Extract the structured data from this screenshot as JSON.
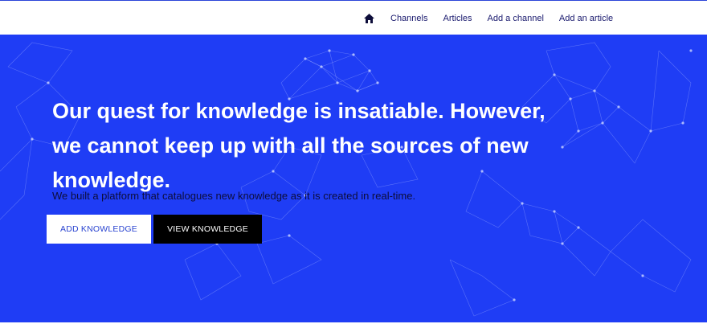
{
  "nav": {
    "home_icon": "home-icon",
    "links": [
      "Channels",
      "Articles",
      "Add a channel",
      "Add an article"
    ]
  },
  "hero": {
    "headline_lines": [
      "Our quest for knowledge is insatiable. However,",
      "we cannot keep up with all the sources of new",
      "knowledge."
    ],
    "subline": "We built a platform that catalogues new knowledge as it is created in real-time.",
    "buttons": {
      "add": "ADD KNOWLEDGE",
      "view": "VIEW KNOWLEDGE"
    }
  },
  "colors": {
    "hero_background": "#1f3df5",
    "nav_text": "#1a1a6e",
    "view_button": "#000000",
    "add_button": "#ffffff"
  }
}
